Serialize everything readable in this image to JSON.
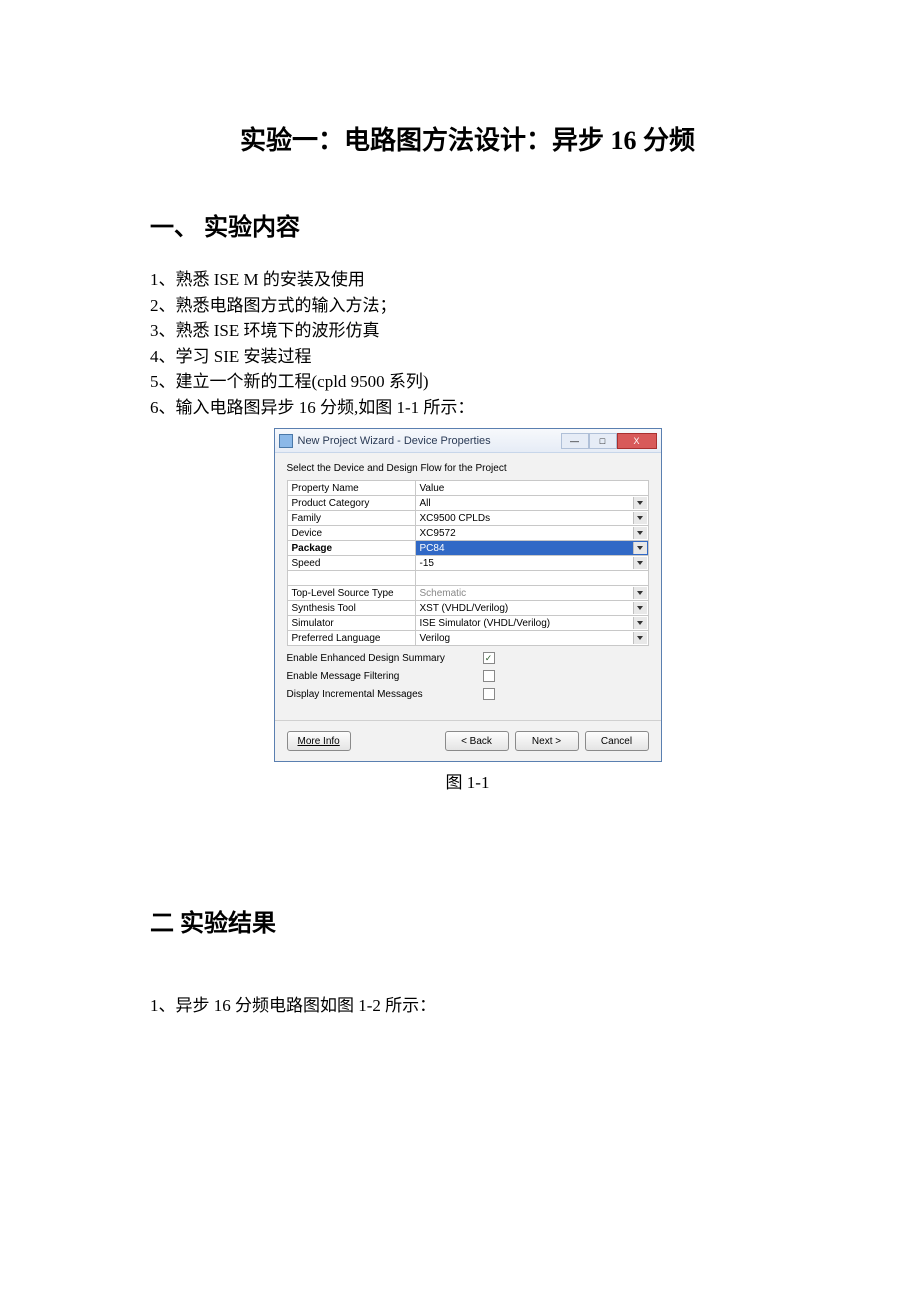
{
  "title": "实验一：电路图方法设计：异步 16 分频",
  "section1_heading": "一、 实验内容",
  "lines": [
    "1、熟悉 ISE M 的安装及使用",
    "2、熟悉电路图方式的输入方法；",
    "3、熟悉 ISE 环境下的波形仿真",
    "4、学习 SIE 安装过程",
    "5、建立一个新的工程(cpld 9500 系列)",
    "6、输入电路图异步 16 分频,如图 1-1 所示："
  ],
  "dialog": {
    "title": "New Project Wizard - Device Properties",
    "instruction": "Select the Device and Design Flow for the Project",
    "header_left": "Property Name",
    "header_right": "Value",
    "rows_top": [
      {
        "name": "Product Category",
        "value": "All",
        "dropdown": true
      },
      {
        "name": "Family",
        "value": "XC9500 CPLDs",
        "dropdown": true
      },
      {
        "name": "Device",
        "value": "XC9572",
        "dropdown": true
      },
      {
        "name": "Package",
        "value": "PC84",
        "dropdown": true,
        "selected": true
      },
      {
        "name": "Speed",
        "value": "-15",
        "dropdown": true
      }
    ],
    "rows_bottom": [
      {
        "name": "Top-Level Source Type",
        "value": "Schematic",
        "dropdown": true,
        "gray": true
      },
      {
        "name": "Synthesis Tool",
        "value": "XST (VHDL/Verilog)",
        "dropdown": true
      },
      {
        "name": "Simulator",
        "value": "ISE Simulator (VHDL/Verilog)",
        "dropdown": true
      },
      {
        "name": "Preferred Language",
        "value": "Verilog",
        "dropdown": true
      }
    ],
    "checks": [
      {
        "label": "Enable Enhanced Design Summary",
        "checked": true
      },
      {
        "label": "Enable Message Filtering",
        "checked": false
      },
      {
        "label": "Display Incremental Messages",
        "checked": false
      }
    ],
    "buttons": {
      "more_info": "More Info",
      "back": "< Back",
      "next": "Next >",
      "cancel": "Cancel"
    },
    "win": {
      "min": "—",
      "max": "□",
      "close": "X"
    }
  },
  "caption1": "图 1-1",
  "section2_heading": "二  实验结果",
  "result_line": "1、异步 16 分频电路图如图 1-2 所示："
}
